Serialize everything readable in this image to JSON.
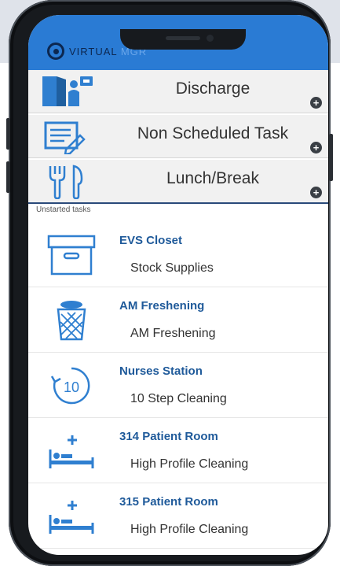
{
  "app": {
    "logo_text_1": "VIRTUAL",
    "logo_text_2": "MGR"
  },
  "actions": [
    {
      "label": "Discharge",
      "icon": "discharge-icon"
    },
    {
      "label": "Non Scheduled Task",
      "icon": "non-scheduled-task-icon"
    },
    {
      "label": "Lunch/Break",
      "icon": "lunch-icon"
    }
  ],
  "section_title": "Unstarted tasks",
  "tasks": [
    {
      "title": "EVS Closet",
      "subtitle": "Stock Supplies",
      "icon": "box-icon"
    },
    {
      "title": "AM Freshening",
      "subtitle": "AM Freshening",
      "icon": "trash-bin-icon"
    },
    {
      "title": "Nurses Station",
      "subtitle": "10 Step Cleaning",
      "icon": "ten-step-icon",
      "icon_text": "10"
    },
    {
      "title": "314 Patient Room",
      "subtitle": "High Profile Cleaning",
      "icon": "hospital-bed-icon"
    },
    {
      "title": "315 Patient Room",
      "subtitle": "High Profile Cleaning",
      "icon": "hospital-bed-icon"
    }
  ],
  "colors": {
    "app_bar": "#2a7bd4",
    "task_title": "#1f5a9a",
    "icon_blue": "#2f7fd0"
  }
}
